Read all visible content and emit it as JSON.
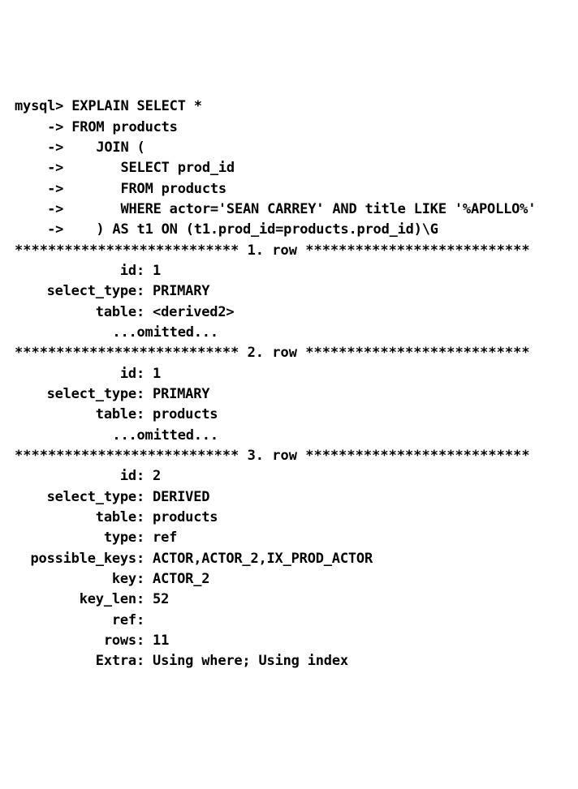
{
  "prompt": "mysql>",
  "cont": "    ->",
  "query": {
    "l1": {
      "pre": " ",
      "kw": "EXPLAIN SELECT",
      "rest": " *"
    },
    "l2": {
      "pre": " ",
      "kw": "FROM products",
      "rest": ""
    },
    "l3": {
      "pre": "    ",
      "kw": "JOIN (",
      "rest": ""
    },
    "l4": {
      "pre": "       ",
      "kw": "SELECT prod_id",
      "rest": ""
    },
    "l5": {
      "pre": "       ",
      "kw": "FROM products",
      "rest": ""
    },
    "l6": {
      "pre": "       ",
      "kw": "WHERE actor='SEAN CARREY' AND title LIKE '%APOLLO%'",
      "rest": ""
    },
    "l7": {
      "pre": "    ",
      "kw": ") AS t1 ON (t1.prod_id=products.prod_id)\\G",
      "rest": ""
    }
  },
  "rows": [
    {
      "sep": "*************************** 1. row ***************************",
      "fields": [
        {
          "label": "id:",
          "value": " 1"
        },
        {
          "label": "select_type:",
          "value": " PRIMARY"
        },
        {
          "label": "table:",
          "value": " <derived2>"
        }
      ],
      "omitted": "            ...omitted..."
    },
    {
      "sep": "*************************** 2. row ***************************",
      "fields": [
        {
          "label": "id:",
          "value": " 1"
        },
        {
          "label": "select_type:",
          "value": " PRIMARY"
        },
        {
          "label": "table:",
          "value": " products"
        }
      ],
      "omitted": "            ...omitted..."
    },
    {
      "sep": "*************************** 3. row ***************************",
      "fields": [
        {
          "label": "id:",
          "value": " 2"
        },
        {
          "label": "select_type:",
          "value": " DERIVED"
        },
        {
          "label": "table:",
          "value": " products"
        },
        {
          "label": "type:",
          "value": " ref"
        },
        {
          "label": "possible_keys:",
          "value": " ACTOR,ACTOR_2,IX_PROD_ACTOR"
        },
        {
          "label": "key:",
          "value": " ACTOR_2"
        },
        {
          "label": "key_len:",
          "value": " 52"
        },
        {
          "label": "ref:",
          "value": ""
        },
        {
          "label": "rows:",
          "value": " 11"
        },
        {
          "label": "Extra:",
          "value": " Using where;",
          "bold_tail": " Using index"
        }
      ],
      "omitted": null
    }
  ]
}
